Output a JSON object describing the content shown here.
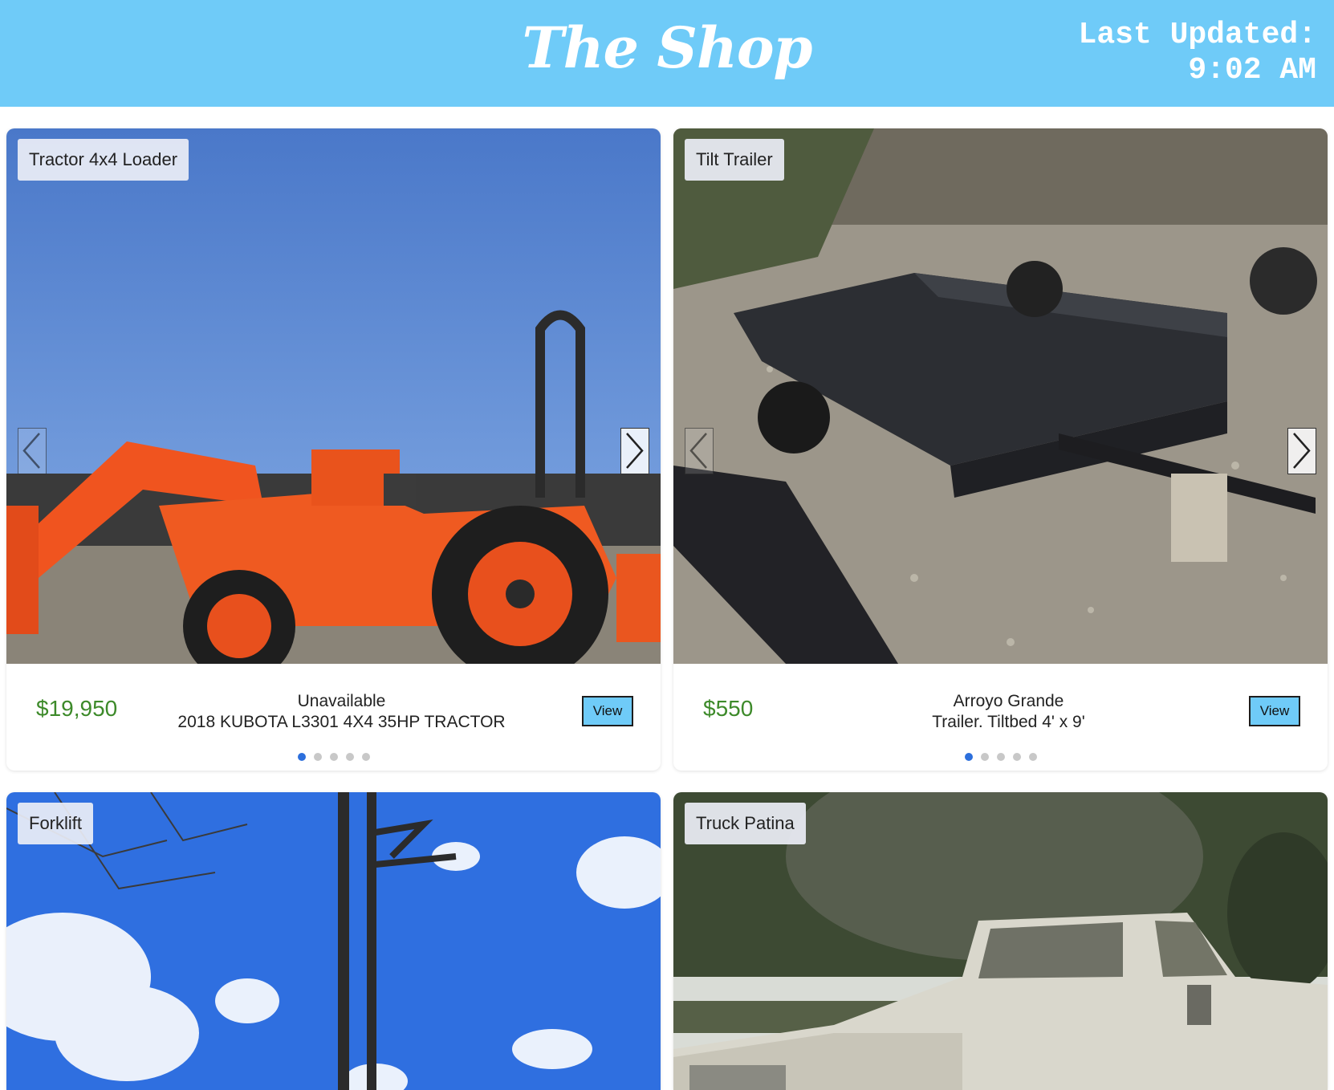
{
  "header": {
    "title": "The Shop",
    "updated_label": "Last Updated:",
    "updated_time": "9:02 AM"
  },
  "colors": {
    "header_bg": "#6fcbf8",
    "price": "#3d8a2a",
    "button": "#6fcbf8",
    "dot_active": "#2c6fdc"
  },
  "listings": [
    {
      "tag": "Tractor 4x4 Loader",
      "price": "$19,950",
      "location": "Unavailable",
      "title": "2018 KUBOTA L3301 4X4 35HP TRACTOR",
      "button": "View",
      "image": "orange-tractor-photo"
    },
    {
      "tag": "Tilt Trailer",
      "price": "$550",
      "location": "Arroyo Grande",
      "title": "Trailer. Tiltbed 4' x 9'",
      "button": "View",
      "image": "tilt-trailer-photo"
    },
    {
      "tag": "Forklift",
      "image": "forklift-photo"
    },
    {
      "tag": "Truck Patina",
      "image": "white-truck-photo"
    }
  ],
  "icons": {
    "prev": "chevron-left-icon",
    "next": "chevron-right-icon",
    "page_dots": "carousel-dot-icon"
  }
}
